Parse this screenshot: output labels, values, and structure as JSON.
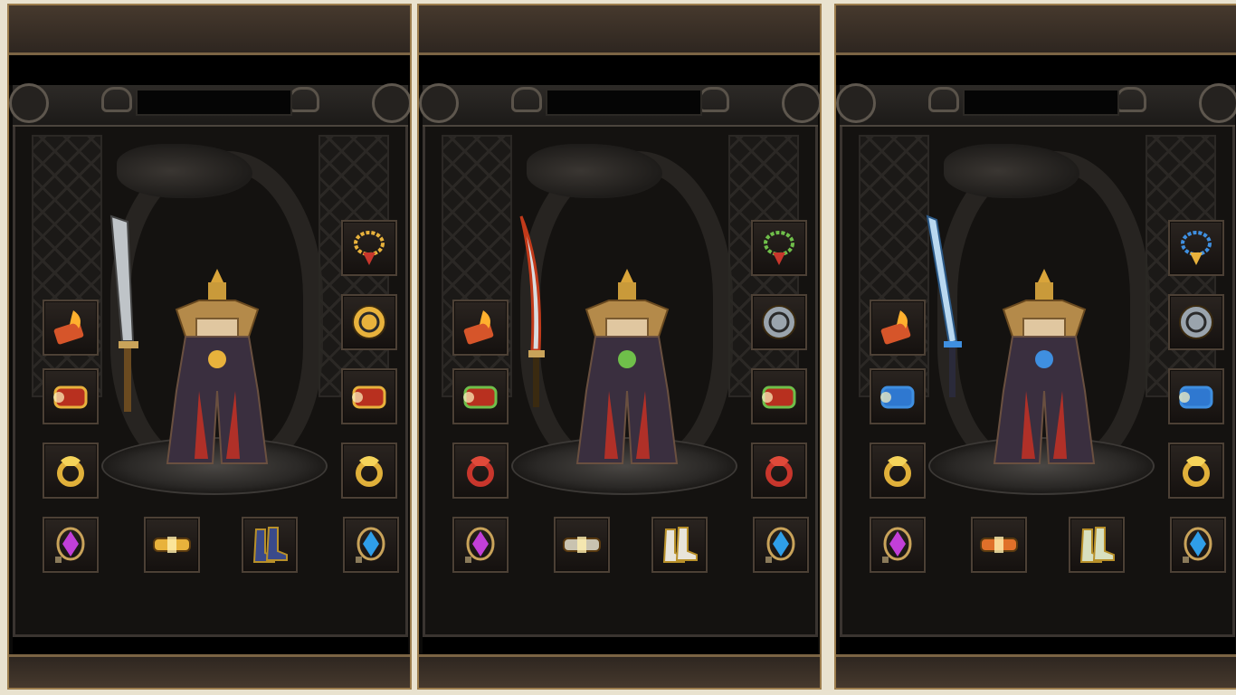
{
  "panels": [
    {
      "weapon_icon": "great-blade-icon",
      "slots": [
        {
          "id": "necklace",
          "icon": "gold-necklace-icon"
        },
        {
          "id": "medal",
          "icon": "gold-medal-icon"
        },
        {
          "id": "talisman",
          "icon": "fire-talisman-icon"
        },
        {
          "id": "bracelet-left",
          "icon": "gold-red-bracelet-icon"
        },
        {
          "id": "bracelet-right",
          "icon": "gold-red-bracelet-icon"
        },
        {
          "id": "ring-left",
          "icon": "gold-ring-icon"
        },
        {
          "id": "ring-right",
          "icon": "gold-ring-icon"
        },
        {
          "id": "gem-left",
          "icon": "purple-gem-icon"
        },
        {
          "id": "belt",
          "icon": "gold-belt-icon"
        },
        {
          "id": "boots",
          "icon": "blue-boots-icon"
        },
        {
          "id": "gem-right",
          "icon": "blue-gem-icon"
        }
      ],
      "colors": {
        "accent": "#e8b23c",
        "secondary": "#c8362c"
      }
    },
    {
      "weapon_icon": "curved-flame-blade-icon",
      "slots": [
        {
          "id": "necklace",
          "icon": "green-necklace-icon"
        },
        {
          "id": "medal",
          "icon": "silver-medal-icon"
        },
        {
          "id": "talisman",
          "icon": "fire-talisman-icon"
        },
        {
          "id": "bracelet-left",
          "icon": "red-bracelet-icon"
        },
        {
          "id": "bracelet-right",
          "icon": "red-bracelet-icon"
        },
        {
          "id": "ring-left",
          "icon": "red-ring-icon"
        },
        {
          "id": "ring-right",
          "icon": "red-ring-icon"
        },
        {
          "id": "gem-left",
          "icon": "purple-gem-icon"
        },
        {
          "id": "belt",
          "icon": "silver-belt-icon"
        },
        {
          "id": "boots",
          "icon": "white-boots-icon"
        },
        {
          "id": "gem-right",
          "icon": "blue-gem-icon"
        }
      ],
      "colors": {
        "accent": "#6fbf4a",
        "secondary": "#c8362c"
      }
    },
    {
      "weapon_icon": "blue-long-sword-icon",
      "slots": [
        {
          "id": "necklace",
          "icon": "blue-gold-necklace-icon"
        },
        {
          "id": "medal",
          "icon": "silver-medal-icon"
        },
        {
          "id": "talisman",
          "icon": "fire-talisman-icon"
        },
        {
          "id": "bracelet-left",
          "icon": "blue-bracelet-icon"
        },
        {
          "id": "bracelet-right",
          "icon": "blue-bracelet-icon"
        },
        {
          "id": "ring-left",
          "icon": "gold-ring-icon"
        },
        {
          "id": "ring-right",
          "icon": "gold-ring-icon"
        },
        {
          "id": "gem-left",
          "icon": "purple-gem-icon"
        },
        {
          "id": "belt",
          "icon": "orange-belt-icon"
        },
        {
          "id": "boots",
          "icon": "green-boots-icon"
        },
        {
          "id": "gem-right",
          "icon": "blue-gem-icon"
        }
      ],
      "colors": {
        "accent": "#3f8fe0",
        "secondary": "#e8b23c"
      }
    }
  ]
}
